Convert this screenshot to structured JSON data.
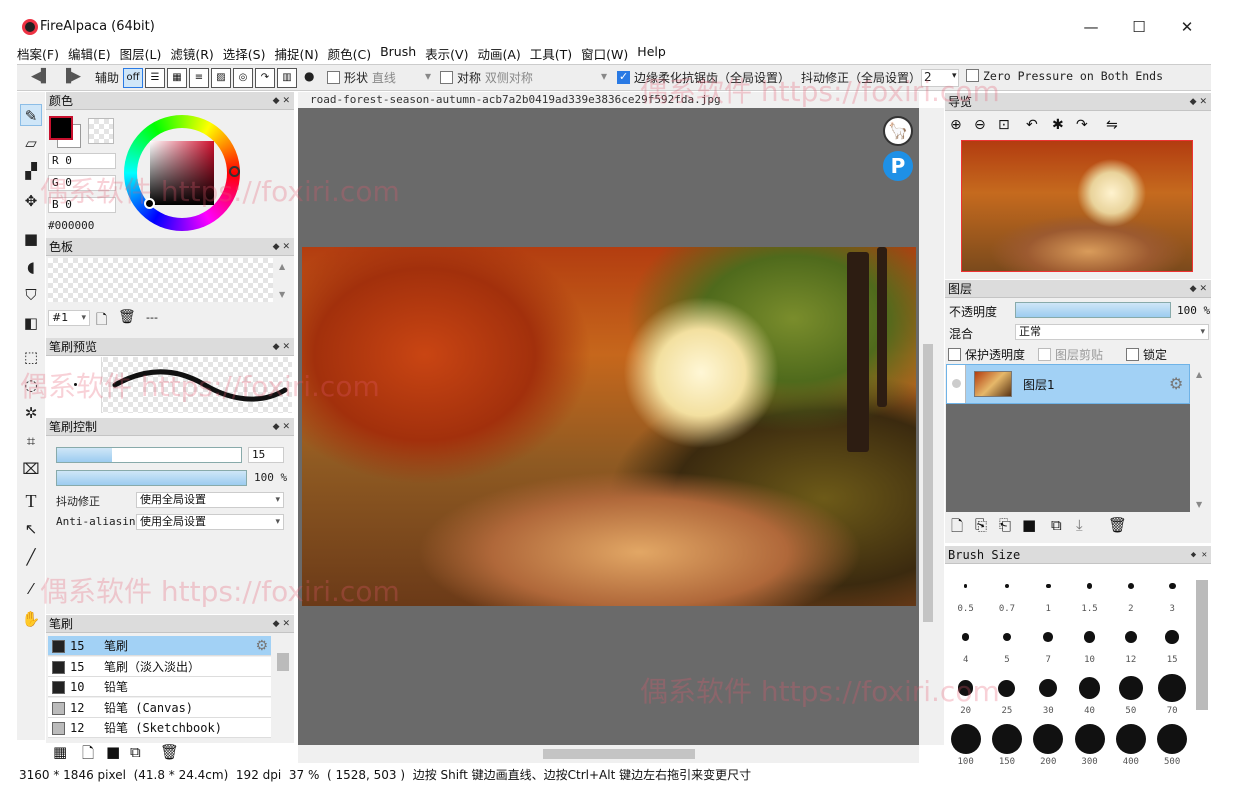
{
  "window": {
    "title": "FireAlpaca (64bit)",
    "min": "—",
    "max": "☐",
    "close": "✕"
  },
  "menu": [
    "档案(F)",
    "编辑(E)",
    "图层(L)",
    "滤镜(R)",
    "选择(S)",
    "捕捉(N)",
    "颜色(C)",
    "Brush",
    "表示(V)",
    "动画(A)",
    "工具(T)",
    "窗口(W)",
    "Help"
  ],
  "toolbar": {
    "assist_label": "辅助",
    "off_label": "off",
    "shape_label": "形状",
    "shape_value": "直线",
    "symmetry_label": "对称",
    "symmetry_value": "双侧对称",
    "antialias_label": "边缘柔化抗锯齿（全局设置）",
    "stabilizer_label": "抖动修正（全局设置）",
    "stabilizer_value": "2",
    "zero_pressure_label": "Zero Pressure on Both Ends"
  },
  "color_panel": {
    "title": "颜色",
    "r": "R 0",
    "g": "G 0",
    "b": "B 0",
    "hex": "#000000",
    "primary": "#000000",
    "accent": "#c8102e"
  },
  "palette_panel": {
    "title": "色板",
    "index": "#1",
    "dash": "---"
  },
  "brush_preview": {
    "title": "笔刷预览"
  },
  "brush_control": {
    "title": "笔刷控制",
    "size_value": "15",
    "size_fraction": 0.3,
    "opacity_value": "100",
    "opacity_unit": "%",
    "opacity_fraction": 1.0,
    "stabilizer_label": "抖动修正",
    "stabilizer_value": "使用全局设置",
    "antialias_label": "Anti-aliasin",
    "antialias_value": "使用全局设置"
  },
  "brush_panel": {
    "title": "笔刷",
    "items": [
      {
        "size": "15",
        "name": "笔刷",
        "color": "#222222"
      },
      {
        "size": "15",
        "name": "笔刷（淡入淡出）",
        "color": "#222222"
      },
      {
        "size": "10",
        "name": "铅笔",
        "color": "#222222"
      },
      {
        "size": "12",
        "name": "铅笔 (Canvas)",
        "color": "#bbbbbb"
      },
      {
        "size": "12",
        "name": "铅笔 (Sketchbook)",
        "color": "#bbbbbb"
      }
    ]
  },
  "document": {
    "filename": "road-forest-season-autumn-acb7a2b0419ad339e3836ce29f592fda.jpg"
  },
  "navigator": {
    "title": "导览"
  },
  "layers_panel": {
    "title": "图层",
    "opacity_label": "不透明度",
    "opacity_value": "100",
    "opacity_unit": "%",
    "opacity_fraction": 1.0,
    "blend_label": "混合",
    "blend_value": "正常",
    "protect_alpha": "保护透明度",
    "clipping": "图层剪贴",
    "lock": "锁定",
    "layers": [
      {
        "name": "图层1"
      }
    ]
  },
  "brush_size_panel": {
    "title": "Brush Size",
    "sizes": [
      "0.5",
      "0.7",
      "1",
      "1.5",
      "2",
      "3",
      "4",
      "5",
      "7",
      "10",
      "12",
      "15",
      "20",
      "25",
      "30",
      "40",
      "50",
      "70",
      "100",
      "150",
      "200",
      "300",
      "400",
      "500"
    ]
  },
  "status": {
    "dimensions": "3160 * 1846 pixel",
    "physical": "(41.8 * 24.4cm)",
    "dpi": "192 dpi",
    "zoom": "37 %",
    "coords": "( 1528, 503 )",
    "hint": "边按 Shift 键边画直线、边按Ctrl+Alt 键边左右拖引来变更尺寸"
  },
  "watermarks": [
    "偶系软件 https://foxiri.com"
  ]
}
